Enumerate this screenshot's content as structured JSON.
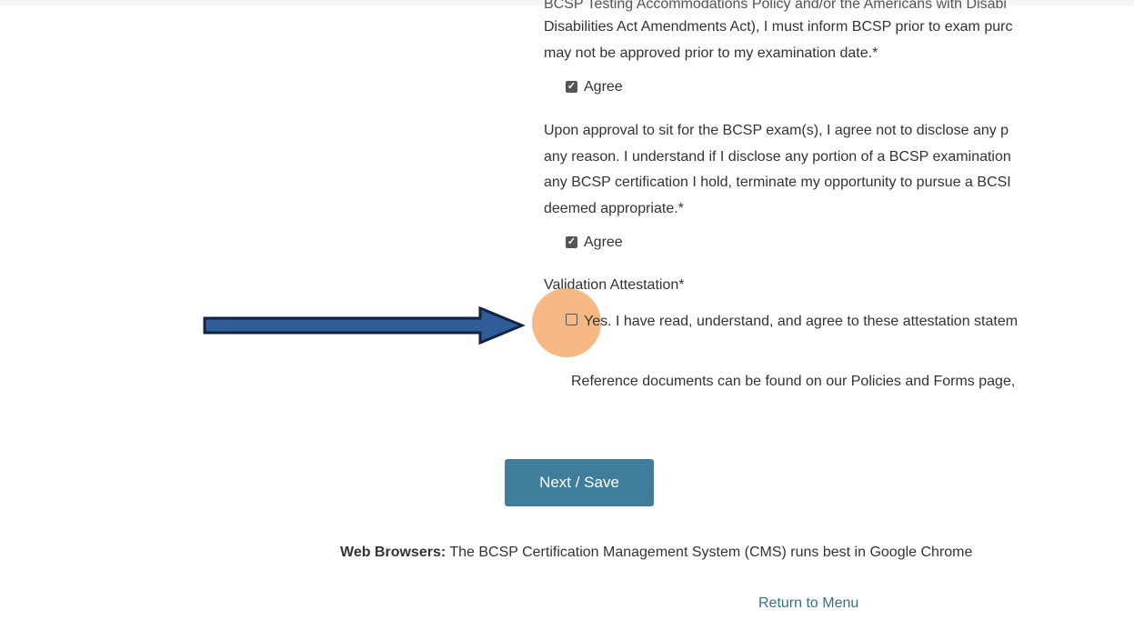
{
  "form": {
    "para1": {
      "lines": [
        "BCSP Testing Accommodations Policy and/or the Americans with Disabi",
        "Disabilities Act Amendments Act), I must inform BCSP prior to exam purc",
        "may not be approved prior to my examination date.*"
      ],
      "agree_label": "Agree",
      "agree_checked": true
    },
    "para2": {
      "lines": [
        "Upon approval to sit for the BCSP exam(s), I agree not to disclose any p",
        "any reason. I understand if I disclose any portion of a BCSP examination",
        "any BCSP certification I hold, terminate my opportunity to pursue a BCSI",
        "deemed appropriate.*"
      ],
      "agree_label": "Agree",
      "agree_checked": true
    },
    "validation": {
      "heading": "Validation Attestation*",
      "option_label": "Yes. I have read, understand, and agree to these attestation statem",
      "checked": false
    },
    "reference_text": "Reference documents can be found on our Policies and Forms page,",
    "next_button": "Next / Save"
  },
  "footer": {
    "browsers_label": "Web Browsers:",
    "browsers_text": " The BCSP Certification Management System (CMS) runs best in Google Chrome",
    "return_link": "Return to Menu"
  },
  "annotation": {
    "arrow_color": "#2e5d9a",
    "highlight_color": "#f4a060"
  }
}
